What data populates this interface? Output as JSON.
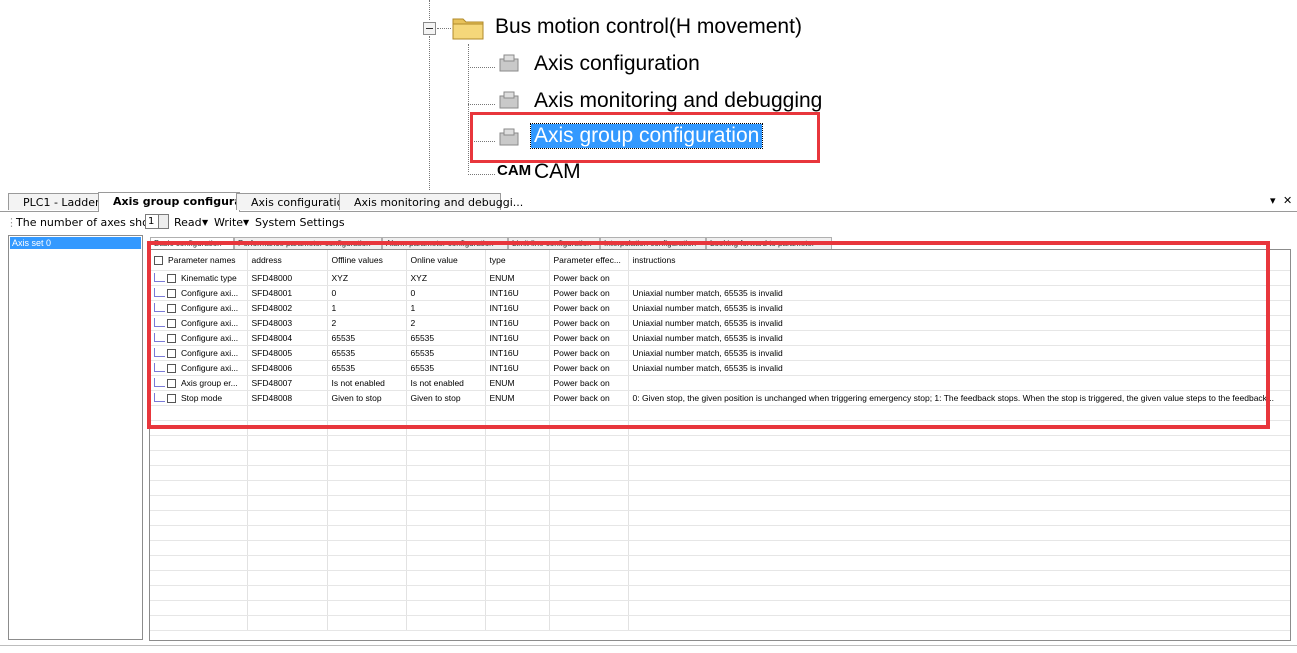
{
  "tree": {
    "root_label": "Bus motion control(H movement)",
    "items": [
      {
        "label": "Axis configuration",
        "icon": "gear-icon",
        "selected": false
      },
      {
        "label": "Axis monitoring and debugging",
        "icon": "gear-icon",
        "selected": false
      },
      {
        "label": "Axis group configuration",
        "icon": "gear-icon",
        "selected": true
      },
      {
        "label": "CAM",
        "icon": "CAM",
        "selected": false
      }
    ]
  },
  "tabs": [
    {
      "label": "PLC1 - Ladder",
      "active": false
    },
    {
      "label": "Axis group configuration",
      "active": true
    },
    {
      "label": "Axis configuration",
      "active": false
    },
    {
      "label": "Axis monitoring and debuggi...",
      "active": false
    }
  ],
  "tab_controls": {
    "dropdown": "▾",
    "close": "✕"
  },
  "toolbar": {
    "axes_label": "The number of axes shown",
    "axes_value": "1",
    "read": "Read",
    "write": "Write",
    "system_settings": "System Settings"
  },
  "left_list": {
    "items": [
      "Axis set 0"
    ]
  },
  "inner_tabs": [
    "Basic configuration",
    "Performance parameter configuration",
    "Alarm parameter configuration",
    "Limit line configuration",
    "Interpolation configuration",
    "Looking forward to parameter"
  ],
  "grid": {
    "columns": [
      "Parameter names",
      "address",
      "Offline values",
      "Online value",
      "type",
      "Parameter effec...",
      "instructions"
    ],
    "rows": [
      {
        "name": "Kinematic type",
        "address": "SFD48000",
        "offline": "XYZ",
        "online": "XYZ",
        "type": "ENUM",
        "effect": "Power back on",
        "instructions": ""
      },
      {
        "name": "Configure axi...",
        "address": "SFD48001",
        "offline": "0",
        "online": "0",
        "type": "INT16U",
        "effect": "Power back on",
        "instructions": "Uniaxial number match, 65535 is invalid"
      },
      {
        "name": "Configure axi...",
        "address": "SFD48002",
        "offline": "1",
        "online": "1",
        "type": "INT16U",
        "effect": "Power back on",
        "instructions": "Uniaxial number match, 65535 is invalid"
      },
      {
        "name": "Configure axi...",
        "address": "SFD48003",
        "offline": "2",
        "online": "2",
        "type": "INT16U",
        "effect": "Power back on",
        "instructions": "Uniaxial number match, 65535 is invalid"
      },
      {
        "name": "Configure axi...",
        "address": "SFD48004",
        "offline": "65535",
        "online": "65535",
        "type": "INT16U",
        "effect": "Power back on",
        "instructions": "Uniaxial number match, 65535 is invalid"
      },
      {
        "name": "Configure axi...",
        "address": "SFD48005",
        "offline": "65535",
        "online": "65535",
        "type": "INT16U",
        "effect": "Power back on",
        "instructions": "Uniaxial number match, 65535 is invalid"
      },
      {
        "name": "Configure axi...",
        "address": "SFD48006",
        "offline": "65535",
        "online": "65535",
        "type": "INT16U",
        "effect": "Power back on",
        "instructions": "Uniaxial number match, 65535 is invalid"
      },
      {
        "name": "Axis group er...",
        "address": "SFD48007",
        "offline": "Is not enabled",
        "online": "Is not enabled",
        "type": "ENUM",
        "effect": "Power back on",
        "instructions": ""
      },
      {
        "name": "Stop mode",
        "address": "SFD48008",
        "offline": "Given to stop",
        "online": "Given to stop",
        "type": "ENUM",
        "effect": "Power back on",
        "instructions": "0: Given stop, the given position is unchanged when triggering emergency stop; 1: The feedback stops. When the stop is triggered, the given value steps to the feedback..."
      }
    ]
  },
  "colors": {
    "highlight_box": "#e8363c",
    "selection": "#3399ff"
  }
}
